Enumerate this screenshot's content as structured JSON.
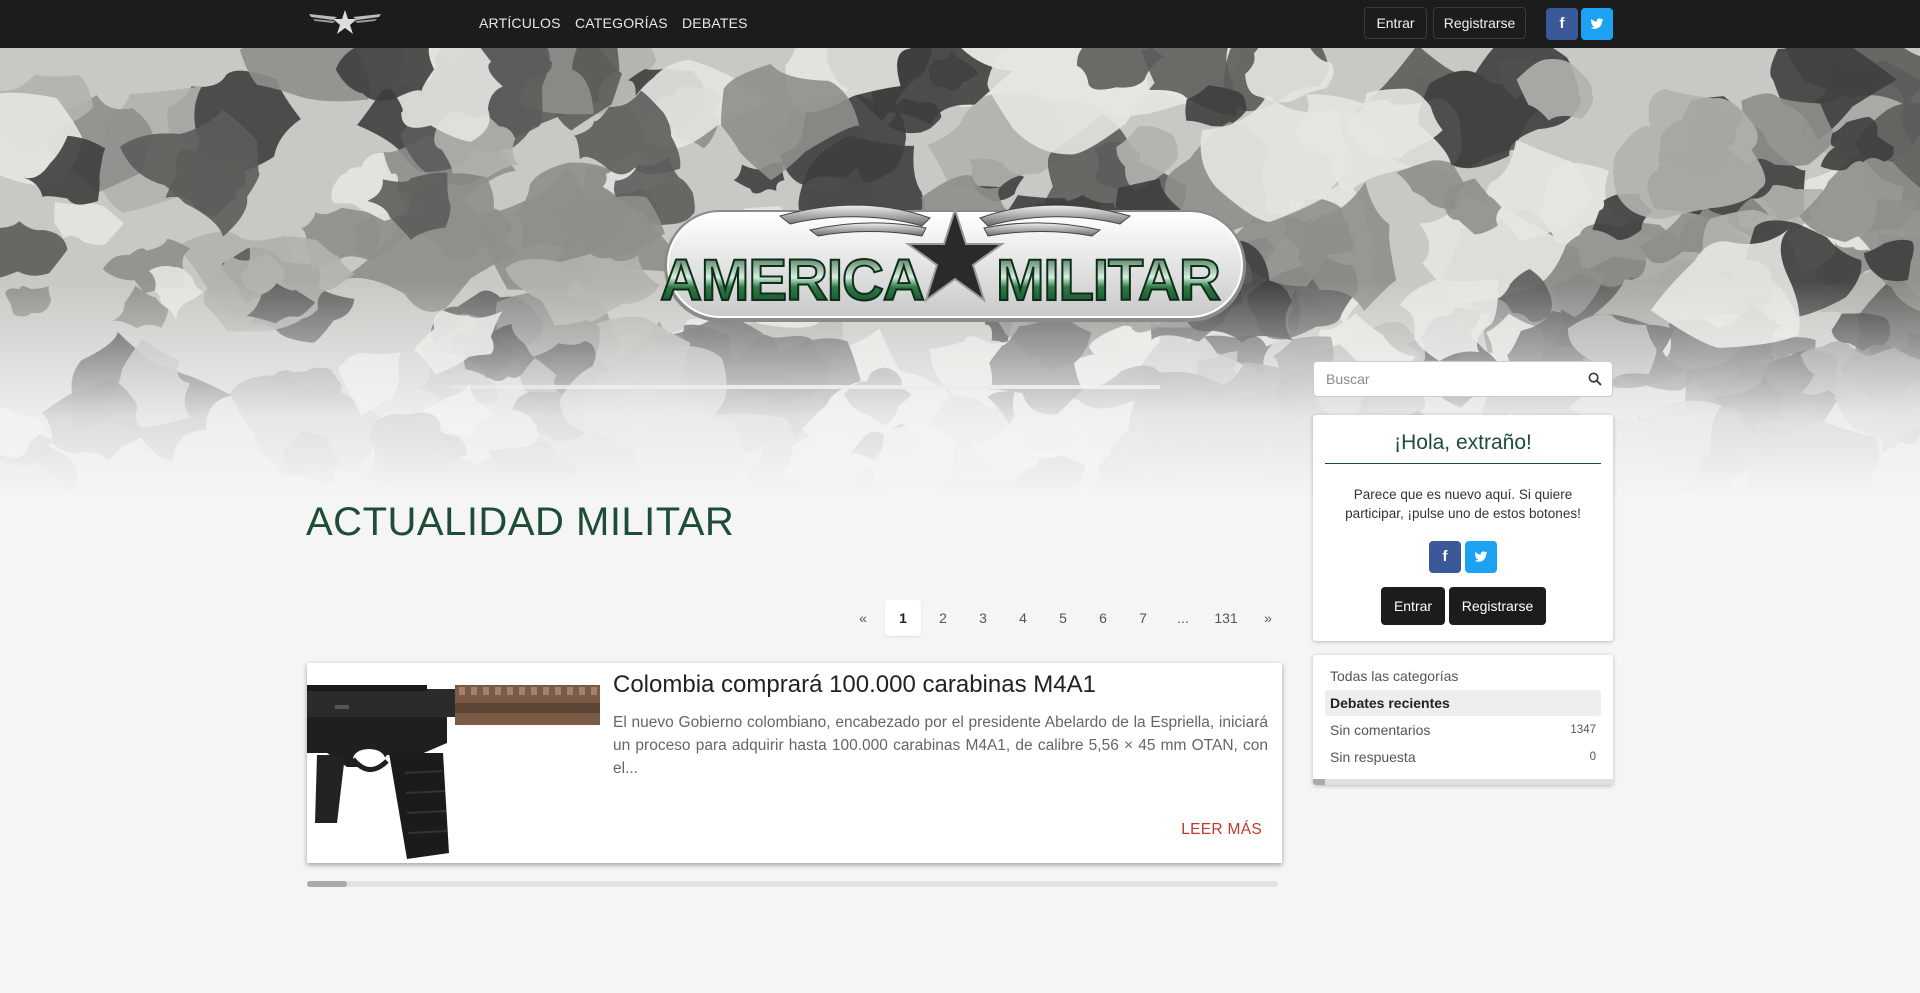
{
  "nav": {
    "links": [
      "ARTÍCULOS",
      "CATEGORÍAS",
      "DEBATES"
    ],
    "login": "Entrar",
    "register": "Registrarse",
    "social": {
      "facebook": "f",
      "twitter": "t"
    }
  },
  "hero": {
    "brand_text": "AMERICA MILITAR"
  },
  "main": {
    "title": "ACTUALIDAD MILITAR",
    "pagination": [
      "«",
      "1",
      "2",
      "3",
      "4",
      "5",
      "6",
      "7",
      "...",
      "131",
      "»"
    ],
    "current_page": "1",
    "articles": [
      {
        "title": "Colombia comprará 100.000 carabinas M4A1",
        "excerpt": "El nuevo Gobierno colombiano, encabezado por el presidente Abelardo de la Espriella, iniciará un proceso para adquirir hasta 100.000 carabinas M4A1, de calibre 5,56 × 45 mm OTAN, con el...",
        "read_more": "LEER MÁS"
      }
    ]
  },
  "sidebar": {
    "search_placeholder": "Buscar",
    "hello": {
      "title": "¡Hola, extraño!",
      "text": "Parece que es nuevo aquí. Si quiere participar, ¡pulse uno de estos botones!",
      "login": "Entrar",
      "register": "Registrarse"
    },
    "categories": [
      {
        "label": "Todas las categorías",
        "count": ""
      },
      {
        "label": "Debates recientes",
        "count": ""
      },
      {
        "label": "Sin comentarios",
        "count": "1347"
      },
      {
        "label": "Sin respuesta",
        "count": "0"
      }
    ]
  },
  "colors": {
    "nav_bg": "#1c1c1c",
    "title_green": "#1e4d36",
    "read_more_red": "#c0392b",
    "facebook": "#3b5998",
    "twitter": "#1da1f2"
  },
  "icons": [
    "site-logo-icon",
    "facebook-icon",
    "twitter-icon",
    "search-icon"
  ]
}
